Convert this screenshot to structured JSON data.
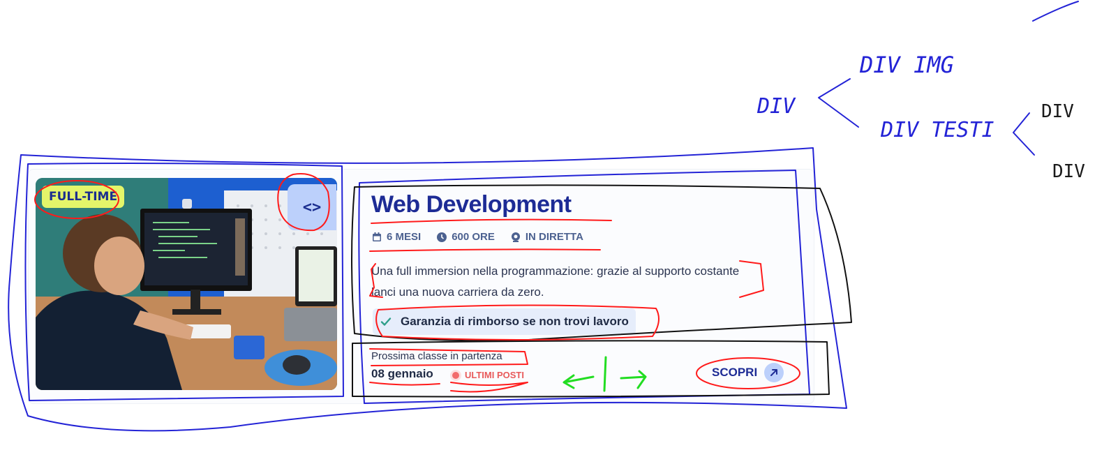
{
  "card": {
    "badge": "FULL-TIME",
    "code_icon": "code-brackets-icon",
    "title": "Web Development",
    "meta": [
      {
        "icon": "calendar-icon",
        "label": "6 MESI"
      },
      {
        "icon": "clock-icon",
        "label": "600 ORE"
      },
      {
        "icon": "webcam-icon",
        "label": "IN DIRETTA"
      }
    ],
    "description": "Una full immersion nella programmazione: grazie al supporto costante lanci una nuova carriera da zero.",
    "guarantee": "Garanzia di rimborso se non trovi lavoro",
    "next_class_label": "Prossima classe in partenza",
    "next_class_date": "08 gennaio",
    "last_spots": "ULTIMI POSTI",
    "cta": "SCOPRI"
  },
  "annotations": {
    "root": "DIV",
    "child_img": "DIV IMG",
    "child_texts": "DIV TESTI",
    "sub_1": "DIV",
    "sub_2": "DIV"
  },
  "colors": {
    "accent": "#1d2b95",
    "badge_bg": "#e4f56a",
    "button_bg": "#bcd0fb",
    "alert": "#e85a5a",
    "sketch_blue": "#2323d6",
    "sketch_red": "#ff1a1a",
    "sketch_green": "#22dd22"
  }
}
